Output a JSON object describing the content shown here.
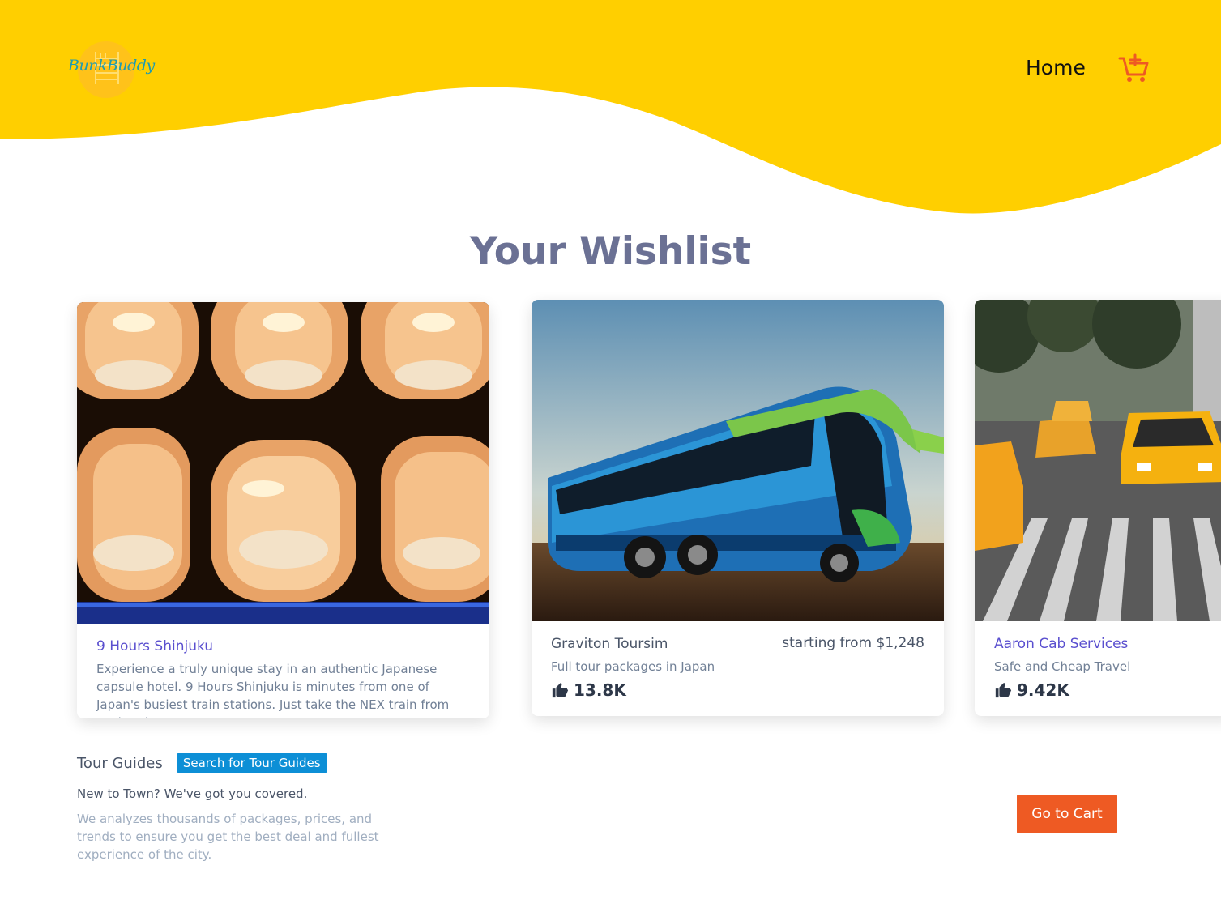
{
  "header": {
    "logo_text": "BunkBuddy",
    "nav_home": "Home",
    "cart_icon": "cart-add-icon",
    "brand_color": "#FFCF00"
  },
  "page_title": "Your Wishlist",
  "cards": [
    {
      "title": "9 Hours Shinjuku",
      "description": "Experience a truly unique stay in an authentic Japanese capsule hotel. 9 Hours Shinjuku is minutes from one of Japan's busiest train stations. Just take the NEX train from Narita airport!",
      "image": "capsule-hotel-image"
    },
    {
      "title": "Graviton Toursim",
      "price": "starting from $1,248",
      "description": "Full tour packages in Japan",
      "likes": "13.8K",
      "image": "tour-bus-image"
    },
    {
      "title": "Aaron Cab Services",
      "description": "Safe and Cheap Travel",
      "likes": "9.42K",
      "image": "yellow-taxi-image"
    }
  ],
  "guides": {
    "label": "Tour Guides",
    "button": "Search for Tour Guides",
    "subtitle": "New to Town? We've got you covered.",
    "description": "We analyzes thousands of packages, prices, and trends to ensure you get the best deal and fullest experience of the city."
  },
  "cart_button": "Go to Cart"
}
